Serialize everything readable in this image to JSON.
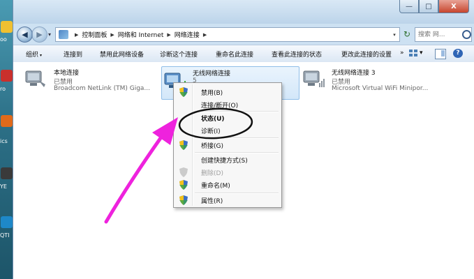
{
  "desktop": {
    "labels": [
      "oo",
      "ro",
      "ics",
      "YE",
      "QTI"
    ]
  },
  "window_controls": {
    "minimize": "—",
    "maximize": "□",
    "close": "X"
  },
  "nav": {
    "back": "◀",
    "forward": "▶",
    "recent": "▾"
  },
  "address": {
    "crumbs": [
      "控制面板",
      "网络和 Internet",
      "网络连接"
    ],
    "separator": "▶",
    "dropdown": "▾",
    "refresh": "↻"
  },
  "search": {
    "placeholder": "搜索 网..."
  },
  "toolbar": {
    "organize": "组织",
    "organize_dd": "▾",
    "items": [
      "连接到",
      "禁用此网络设备",
      "诊断这个连接",
      "重命名此连接",
      "查看此连接的状态",
      "更改此连接的设置"
    ],
    "overflow": "»",
    "views_dd": "▾",
    "help": "?"
  },
  "connections": [
    {
      "name": "本地连接",
      "status": "已禁用",
      "adapter": "Broadcom NetLink (TM) Giga..."
    },
    {
      "name": "无线网络连接",
      "status": "5",
      "adapter": ""
    },
    {
      "name": "无线网络连接 3",
      "status": "已禁用",
      "adapter": "Microsoft Virtual WiFi Minipor..."
    }
  ],
  "context_menu": {
    "items": [
      {
        "label": "禁用(B)",
        "shield": true
      },
      {
        "label": "连接/断开(O)"
      },
      {
        "label": "状态(U)",
        "bold": true
      },
      {
        "label": "诊断(I)"
      },
      {
        "label": "桥接(G)",
        "shield": true
      },
      {
        "label": "创建快捷方式(S)"
      },
      {
        "label": "删除(D)",
        "shield": true,
        "disabled": true
      },
      {
        "label": "重命名(M)",
        "shield": true
      },
      {
        "label": "属性(R)",
        "shield": true
      }
    ]
  },
  "annotation": {
    "arrow_color": "#ee22dd",
    "circle_color": "#111111"
  },
  "colors": {
    "selection": "#d3e7f9",
    "window_frame": "#cde1f2",
    "close_button": "#c7452d"
  }
}
